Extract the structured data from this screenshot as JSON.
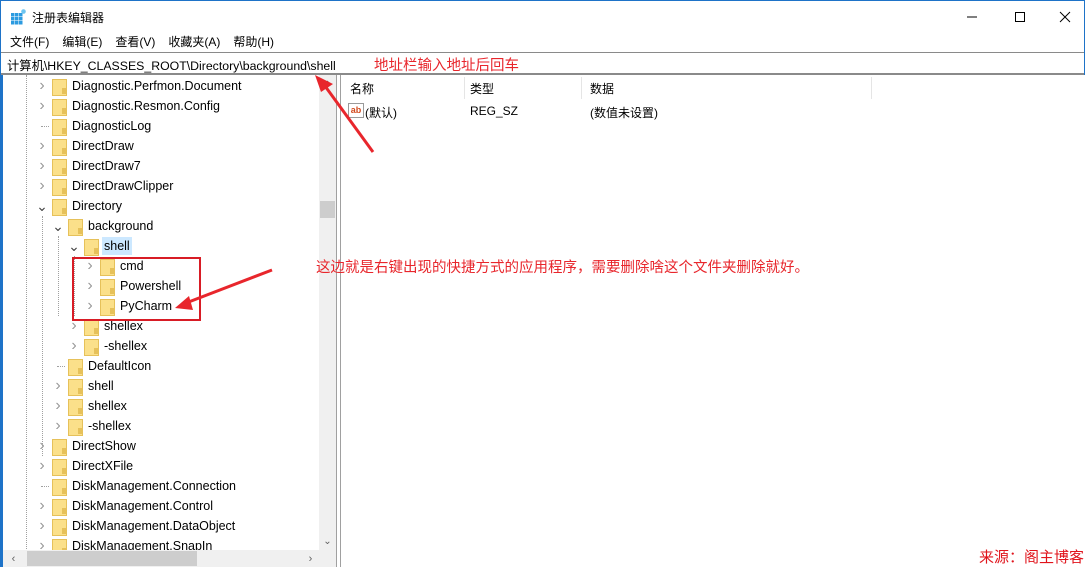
{
  "window": {
    "title": "注册表编辑器",
    "icon": "registry-editor-icon",
    "controls": {
      "minimize": "minimize-icon",
      "maximize": "maximize-icon",
      "close": "close-icon"
    }
  },
  "menubar": {
    "items": [
      {
        "label": "文件(F)"
      },
      {
        "label": "编辑(E)"
      },
      {
        "label": "查看(V)"
      },
      {
        "label": "收藏夹(A)"
      },
      {
        "label": "帮助(H)"
      }
    ]
  },
  "address": {
    "value": "计算机\\HKEY_CLASSES_ROOT\\Directory\\background\\shell"
  },
  "tree": {
    "items": [
      {
        "label": "Diagnostic.Perfmon.Document",
        "level": 0,
        "expander": "collapsed"
      },
      {
        "label": "Diagnostic.Resmon.Config",
        "level": 0,
        "expander": "collapsed"
      },
      {
        "label": "DiagnosticLog",
        "level": 0,
        "expander": "none"
      },
      {
        "label": "DirectDraw",
        "level": 0,
        "expander": "collapsed"
      },
      {
        "label": "DirectDraw7",
        "level": 0,
        "expander": "collapsed"
      },
      {
        "label": "DirectDrawClipper",
        "level": 0,
        "expander": "collapsed"
      },
      {
        "label": "Directory",
        "level": 0,
        "expander": "expanded"
      },
      {
        "label": "background",
        "level": 1,
        "expander": "expanded"
      },
      {
        "label": "shell",
        "level": 2,
        "expander": "expanded",
        "selected": true
      },
      {
        "label": "cmd",
        "level": 3,
        "expander": "collapsed"
      },
      {
        "label": "Powershell",
        "level": 3,
        "expander": "collapsed"
      },
      {
        "label": "PyCharm",
        "level": 3,
        "expander": "collapsed"
      },
      {
        "label": "shellex",
        "level": 2,
        "expander": "collapsed"
      },
      {
        "label": "-shellex",
        "level": 2,
        "expander": "collapsed"
      },
      {
        "label": "DefaultIcon",
        "level": 1,
        "expander": "none"
      },
      {
        "label": "shell",
        "level": 1,
        "expander": "collapsed"
      },
      {
        "label": "shellex",
        "level": 1,
        "expander": "collapsed"
      },
      {
        "label": "-shellex",
        "level": 1,
        "expander": "collapsed"
      },
      {
        "label": "DirectShow",
        "level": 0,
        "expander": "collapsed"
      },
      {
        "label": "DirectXFile",
        "level": 0,
        "expander": "collapsed"
      },
      {
        "label": "DiskManagement.Connection",
        "level": 0,
        "expander": "none"
      },
      {
        "label": "DiskManagement.Control",
        "level": 0,
        "expander": "collapsed"
      },
      {
        "label": "DiskManagement.DataObject",
        "level": 0,
        "expander": "collapsed"
      },
      {
        "label": "DiskManagement.SnapIn",
        "level": 0,
        "expander": "collapsed"
      }
    ]
  },
  "values": {
    "columns": [
      {
        "label": "名称"
      },
      {
        "label": "类型"
      },
      {
        "label": "数据"
      }
    ],
    "rows": [
      {
        "name": "(默认)",
        "type": "REG_SZ",
        "data": "(数值未设置)",
        "icon": "string-value-icon"
      }
    ]
  },
  "annotations": {
    "address_note": "地址栏输入地址后回车",
    "tree_note": "这边就是右键出现的快捷方式的应用程序，需要删除啥这个文件夹删除就好。",
    "source": "来源：阁主博客",
    "color": "#e8262c"
  }
}
